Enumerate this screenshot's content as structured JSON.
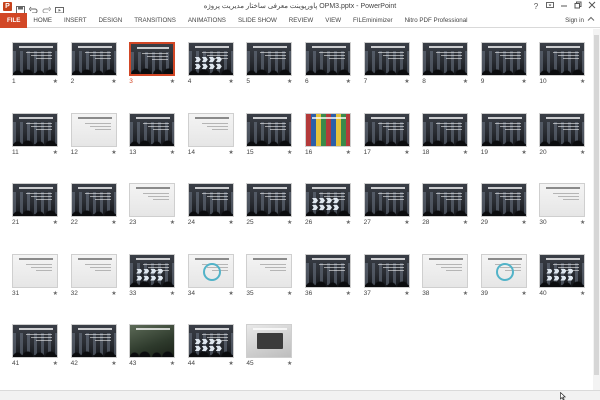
{
  "title_bar": {
    "title": "پاورپوینت معرفی ساختار مدیریت پروژه OPM3.pptx - PowerPoint",
    "qat": {
      "app_icon": "powerpoint-icon",
      "app_icon_glyph": "P",
      "save_icon": "save-icon",
      "undo_icon": "undo-icon",
      "redo_icon": "redo-icon",
      "start_icon": "slideshow-start-icon"
    },
    "window_controls": [
      "help-icon",
      "ribbon-display-icon",
      "minimize-icon",
      "restore-icon",
      "close-icon"
    ]
  },
  "ribbon": {
    "tabs": [
      "FILE",
      "HOME",
      "INSERT",
      "DESIGN",
      "TRANSITIONS",
      "ANIMATIONS",
      "SLIDE SHOW",
      "REVIEW",
      "VIEW",
      "FILEminimizer",
      "Nitro PDF Professional"
    ],
    "sign_in": "Sign in",
    "collapse_icon": "collapse-ribbon-icon"
  },
  "accent_color": "#d24726",
  "slides": [
    {
      "number": "1",
      "variant": "dark"
    },
    {
      "number": "2",
      "variant": "dark"
    },
    {
      "number": "3",
      "variant": "dark",
      "selected": true
    },
    {
      "number": "4",
      "variant": "dark-chevrons"
    },
    {
      "number": "5",
      "variant": "dark"
    },
    {
      "number": "6",
      "variant": "dark"
    },
    {
      "number": "7",
      "variant": "dark"
    },
    {
      "number": "8",
      "variant": "dark"
    },
    {
      "number": "9",
      "variant": "dark"
    },
    {
      "number": "10",
      "variant": "dark"
    },
    {
      "number": "11",
      "variant": "dark"
    },
    {
      "number": "12",
      "variant": "light"
    },
    {
      "number": "13",
      "variant": "dark"
    },
    {
      "number": "14",
      "variant": "light"
    },
    {
      "number": "15",
      "variant": "dark"
    },
    {
      "number": "16",
      "variant": "flags"
    },
    {
      "number": "17",
      "variant": "dark"
    },
    {
      "number": "18",
      "variant": "dark"
    },
    {
      "number": "19",
      "variant": "dark"
    },
    {
      "number": "20",
      "variant": "dark"
    },
    {
      "number": "21",
      "variant": "dark"
    },
    {
      "number": "22",
      "variant": "dark"
    },
    {
      "number": "23",
      "variant": "light"
    },
    {
      "number": "24",
      "variant": "dark"
    },
    {
      "number": "25",
      "variant": "dark"
    },
    {
      "number": "26",
      "variant": "dark-chevrons"
    },
    {
      "number": "27",
      "variant": "dark"
    },
    {
      "number": "28",
      "variant": "dark"
    },
    {
      "number": "29",
      "variant": "dark"
    },
    {
      "number": "30",
      "variant": "light"
    },
    {
      "number": "31",
      "variant": "light"
    },
    {
      "number": "32",
      "variant": "light"
    },
    {
      "number": "33",
      "variant": "dark-chevrons"
    },
    {
      "number": "34",
      "variant": "light-ring"
    },
    {
      "number": "35",
      "variant": "light"
    },
    {
      "number": "36",
      "variant": "dark"
    },
    {
      "number": "37",
      "variant": "dark"
    },
    {
      "number": "38",
      "variant": "light"
    },
    {
      "number": "39",
      "variant": "light-ring"
    },
    {
      "number": "40",
      "variant": "dark-chevrons"
    },
    {
      "number": "41",
      "variant": "dark"
    },
    {
      "number": "42",
      "variant": "dark"
    },
    {
      "number": "43",
      "variant": "photo"
    },
    {
      "number": "44",
      "variant": "dark-chevrons"
    },
    {
      "number": "45",
      "variant": "laptop"
    }
  ],
  "slide_star_icon": "transition-star-icon",
  "slide_star_glyph": "★",
  "status_bar": {
    "text": ""
  }
}
